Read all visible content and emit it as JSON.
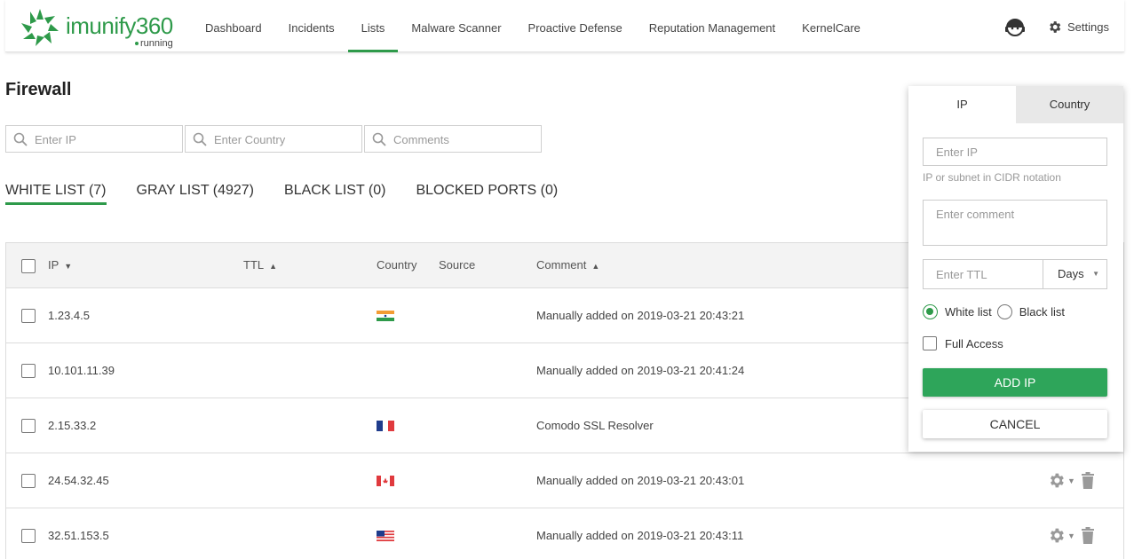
{
  "app": {
    "logo_text": "imunify360",
    "status": "running"
  },
  "nav": {
    "items": [
      {
        "label": "Dashboard"
      },
      {
        "label": "Incidents"
      },
      {
        "label": "Lists"
      },
      {
        "label": "Malware Scanner"
      },
      {
        "label": "Proactive Defense"
      },
      {
        "label": "Reputation Management"
      },
      {
        "label": "KernelCare"
      }
    ],
    "active": "Lists",
    "settings_label": "Settings"
  },
  "page": {
    "title": "Firewall"
  },
  "filters": {
    "ip_placeholder": "Enter IP",
    "country_placeholder": "Enter Country",
    "comments_placeholder": "Comments"
  },
  "tabs": [
    {
      "label": "WHITE LIST (7)"
    },
    {
      "label": "GRAY LIST (4927)"
    },
    {
      "label": "BLACK LIST (0)"
    },
    {
      "label": "BLOCKED PORTS (0)"
    }
  ],
  "table": {
    "headers": {
      "ip": "IP",
      "ttl": "TTL",
      "country": "Country",
      "source": "Source",
      "comment": "Comment"
    },
    "rows": [
      {
        "ip": "1.23.4.5",
        "ttl": "",
        "country_flag": "india",
        "source": "",
        "comment": "Manually added on 2019-03-21 20:43:21"
      },
      {
        "ip": "10.101.11.39",
        "ttl": "",
        "country_flag": "",
        "source": "",
        "comment": "Manually added on 2019-03-21 20:41:24"
      },
      {
        "ip": "2.15.33.2",
        "ttl": "",
        "country_flag": "france",
        "source": "",
        "comment": "Comodo SSL Resolver"
      },
      {
        "ip": "24.54.32.45",
        "ttl": "",
        "country_flag": "canada",
        "source": "",
        "comment": "Manually added on 2019-03-21 20:43:01"
      },
      {
        "ip": "32.51.153.5",
        "ttl": "",
        "country_flag": "usa",
        "source": "",
        "comment": "Manually added on 2019-03-21 20:43:11"
      }
    ]
  },
  "add_popup": {
    "tabs": [
      {
        "label": "IP"
      },
      {
        "label": "Country"
      }
    ],
    "ip_placeholder": "Enter IP",
    "ip_hint": "IP or subnet in CIDR notation",
    "comment_placeholder": "Enter comment",
    "ttl_placeholder": "Enter TTL",
    "ttl_unit": "Days",
    "radio_white": "White list",
    "radio_black": "Black list",
    "full_access": "Full Access",
    "add_button": "ADD IP",
    "cancel_button": "CANCEL"
  },
  "colors": {
    "accent": "#2e9a4a",
    "button_green": "#2ea55a"
  }
}
